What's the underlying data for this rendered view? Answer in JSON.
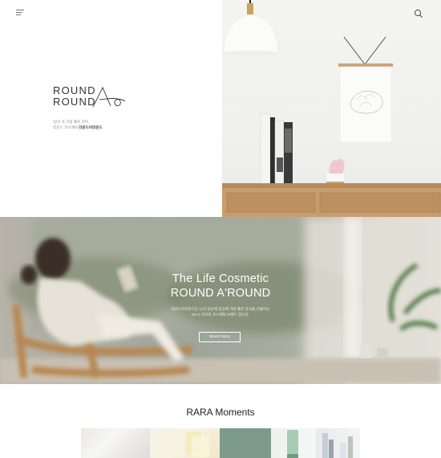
{
  "header": {
    "menu_icon": "hamburger-icon",
    "search_icon": "search-icon"
  },
  "logo": {
    "line1": "ROUND",
    "line2": "ROUND"
  },
  "tagline": {
    "line1": "'당신 속 가장 좋은 것이",
    "line2_prefix": "라운드 코스메틱",
    "line2_brand": "라운드어라운드"
  },
  "banner": {
    "title_line1": "The Life Cosmetic",
    "title_line2": "ROUND A'ROUND",
    "desc_line1": "라운드어라운드는 나의 일상에 일상에 가장 좋은 휴식을 선물하는",
    "desc_line2": "NO.1 라이프 코스메틱 브랜드 입니다.",
    "button_label": "Brand Story"
  },
  "moments": {
    "title": "RARA Moments"
  },
  "colors": {
    "accent_green": "#7e9a8b",
    "text_dark": "#222222"
  }
}
